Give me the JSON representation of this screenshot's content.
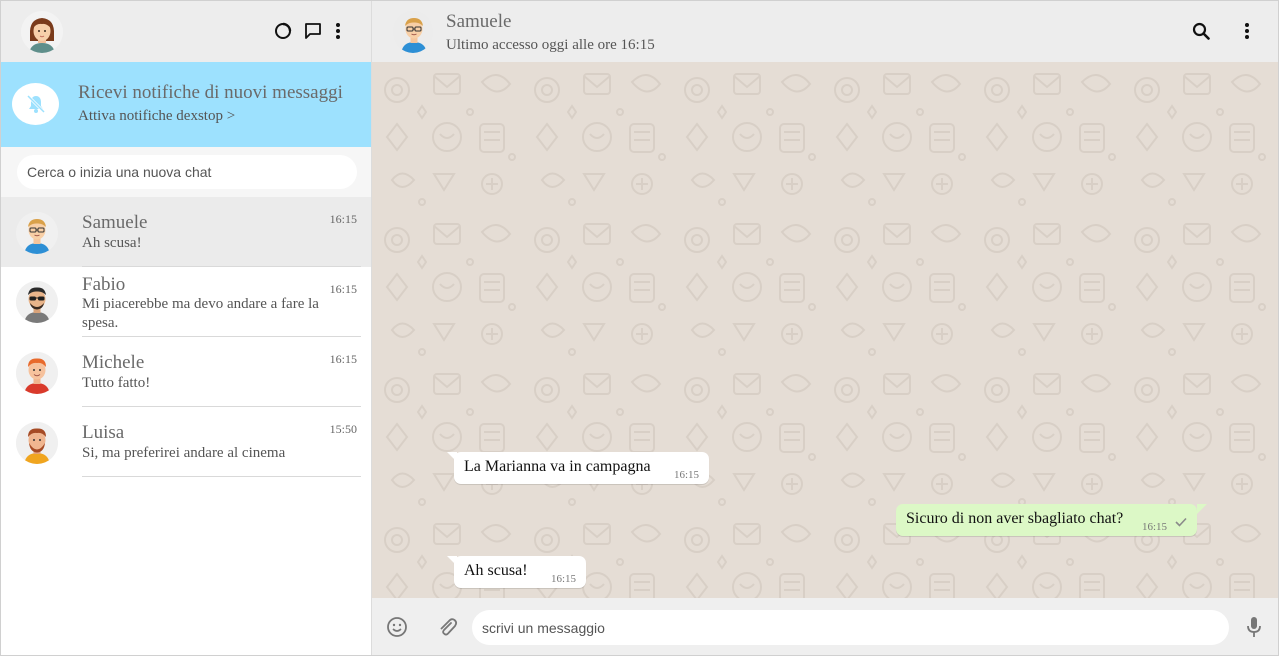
{
  "sidebar": {
    "header": {
      "icons": [
        "status-circle-icon",
        "new-chat-icon",
        "menu-dots-icon"
      ]
    },
    "notification": {
      "title": "Ricevi notifiche di nuovi messaggi",
      "link": "Attiva notifiche dexstop >",
      "icon": "bell-off-icon"
    },
    "search": {
      "placeholder": "Cerca o inizia una nuova chat"
    },
    "chats": [
      {
        "name": "Samuele",
        "last_message": "Ah scusa!",
        "time": "16:15",
        "active": true
      },
      {
        "name": "Fabio",
        "last_message": "Mi piacerebbe ma devo andare a fare la spesa.",
        "time": "16:15",
        "active": false
      },
      {
        "name": "Michele",
        "last_message": "Tutto fatto!",
        "time": "16:15",
        "active": false
      },
      {
        "name": "Luisa",
        "last_message": "Si, ma preferirei andare al cinema",
        "time": "15:50",
        "active": false
      }
    ]
  },
  "conversation": {
    "header": {
      "name": "Samuele",
      "status": "Ultimo accesso oggi alle ore 16:15",
      "icons": [
        "search-icon",
        "menu-dots-icon"
      ]
    },
    "messages": [
      {
        "direction": "received",
        "text": "La Marianna va in campagna",
        "time": "16:15"
      },
      {
        "direction": "sent",
        "text": "Sicuro di non aver sbagliato chat?",
        "time": "16:15",
        "status": "sent-check"
      },
      {
        "direction": "received",
        "text": "Ah scusa!",
        "time": "16:15"
      }
    ],
    "composer": {
      "placeholder": "scrivi un messaggio",
      "icons": [
        "emoji-icon",
        "attach-icon",
        "microphone-icon"
      ]
    }
  },
  "colors": {
    "header_bg": "#ededed",
    "notify_bg": "#9de1fe",
    "chat_bg": "#e5ddd5",
    "sent_bubble": "#dcf8c6",
    "received_bubble": "#ffffff",
    "active_chat_bg": "#ebebeb"
  }
}
